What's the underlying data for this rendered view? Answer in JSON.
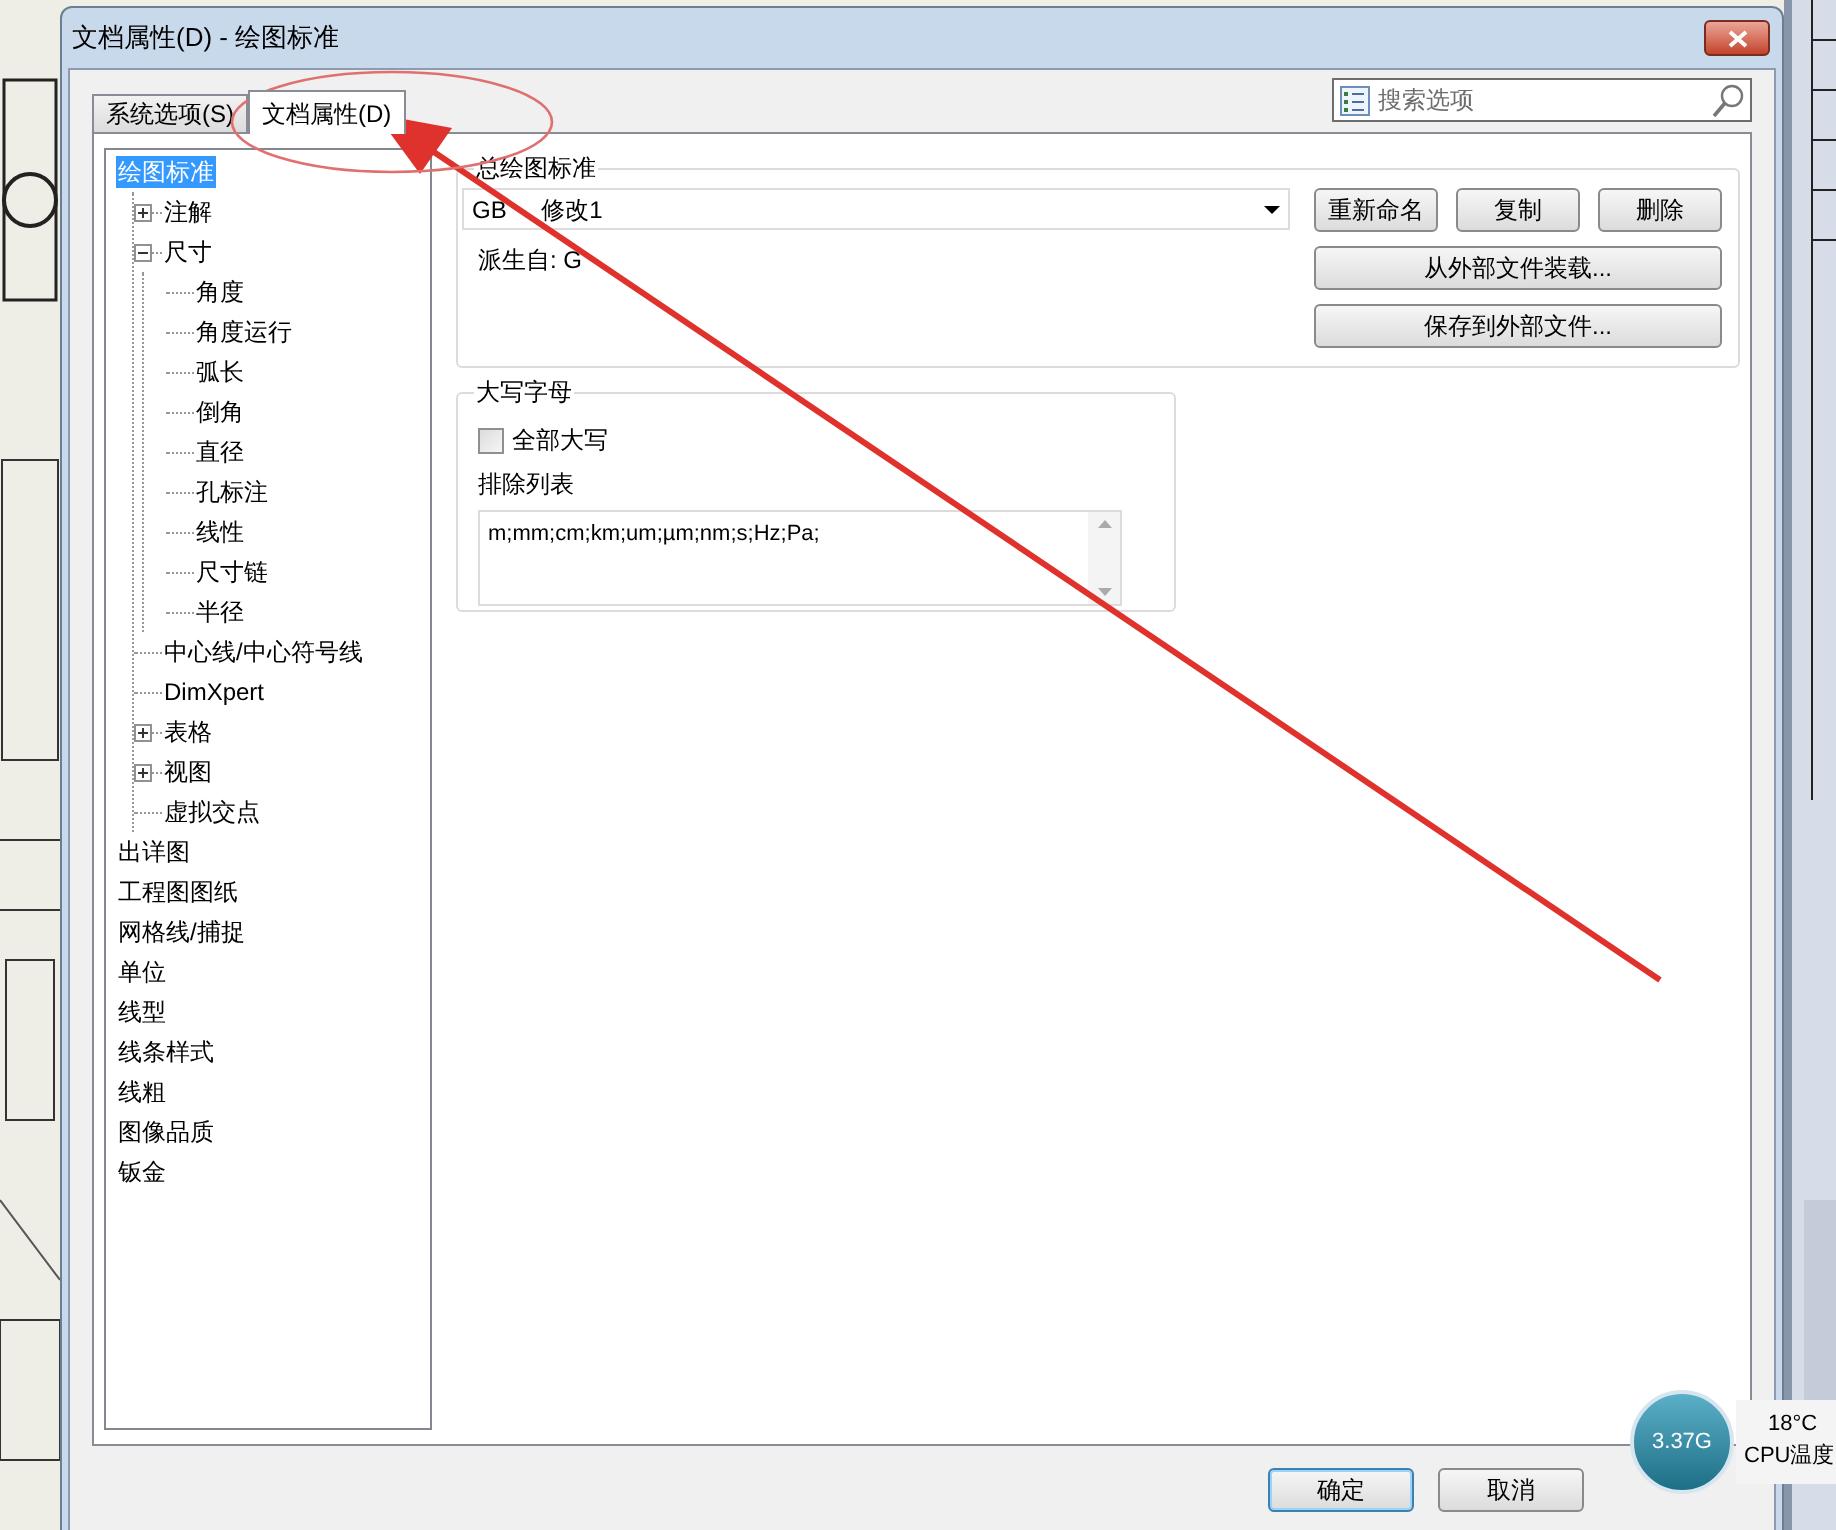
{
  "window": {
    "title": "文档属性(D) - 绘图标准"
  },
  "tabs": [
    {
      "label": "系统选项(S)",
      "selected": false
    },
    {
      "label": "文档属性(D)",
      "selected": true
    }
  ],
  "search": {
    "placeholder": "搜索选项"
  },
  "tree": [
    {
      "label": "绘图标准",
      "selected": true,
      "children": [
        {
          "label": "注解",
          "selected": false,
          "expanded": false
        },
        {
          "label": "尺寸",
          "selected": false,
          "expanded": true,
          "children": [
            {
              "label": "角度",
              "selected": false
            },
            {
              "label": "角度运行",
              "selected": false
            },
            {
              "label": "弧长",
              "selected": false
            },
            {
              "label": "倒角",
              "selected": false
            },
            {
              "label": "直径",
              "selected": false
            },
            {
              "label": "孔标注",
              "selected": false
            },
            {
              "label": "线性",
              "selected": false
            },
            {
              "label": "尺寸链",
              "selected": false
            },
            {
              "label": "半径",
              "selected": false
            }
          ]
        },
        {
          "label": "中心线/中心符号线",
          "selected": false
        },
        {
          "label": "DimXpert",
          "selected": false
        },
        {
          "label": "表格",
          "selected": false,
          "expanded": false
        },
        {
          "label": "视图",
          "selected": false,
          "expanded": false
        },
        {
          "label": "虚拟交点",
          "selected": false
        }
      ]
    },
    {
      "label": "出详图",
      "selected": false
    },
    {
      "label": "工程图图纸",
      "selected": false
    },
    {
      "label": "网格线/捕捉",
      "selected": false
    },
    {
      "label": "单位",
      "selected": false
    },
    {
      "label": "线型",
      "selected": false
    },
    {
      "label": "线条样式",
      "selected": false
    },
    {
      "label": "线粗",
      "selected": false
    },
    {
      "label": "图像品质",
      "selected": false
    },
    {
      "label": "钣金",
      "selected": false
    }
  ],
  "standard_group": {
    "title": "总绘图标准",
    "value": "GB 修改1",
    "derived_label": "派生自: G",
    "buttons": [
      "重新命名",
      "复制",
      "删除"
    ],
    "wide_buttons": [
      "从外部文件装载...",
      "保存到外部文件..."
    ]
  },
  "caps_group": {
    "title": "大写字母",
    "all_caps": {
      "label": "全部大写",
      "checked": false
    },
    "exclude_label": "排除列表",
    "exclude_value": "m;mm;cm;km;um;µm;nm;s;Hz;Pa;"
  },
  "footer_buttons": [
    {
      "label": "确定",
      "default": true
    },
    {
      "label": "取消",
      "default": false
    }
  ],
  "cpu_widget": {
    "speed": "3.37G",
    "temperature": "18°C",
    "label": "CPU温度"
  }
}
